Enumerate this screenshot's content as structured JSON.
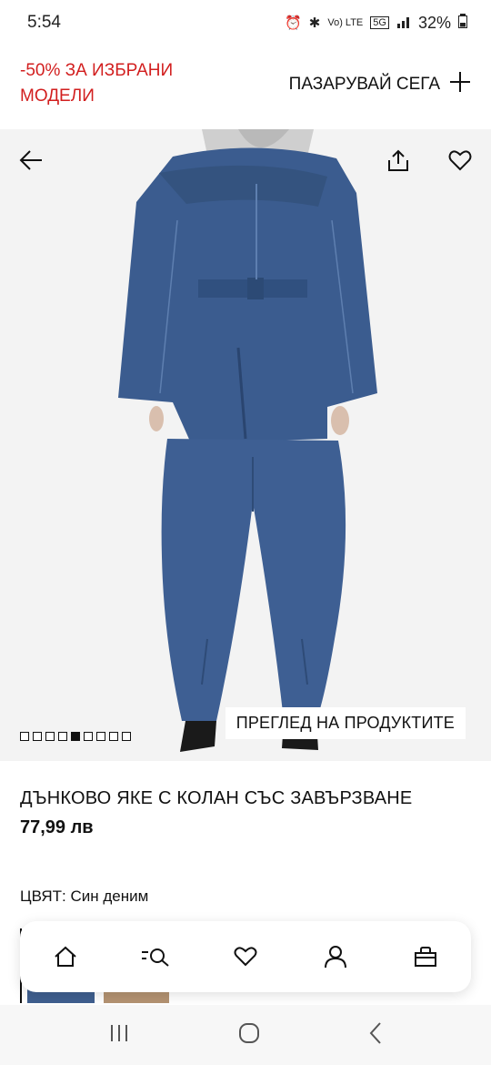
{
  "status_bar": {
    "time": "5:54",
    "network_label": "Vo) LTE",
    "signal_label": "5G",
    "battery": "32%"
  },
  "promo": {
    "text": "-50% ЗА ИЗБРАНИ МОДЕЛИ",
    "cta": "ПАЗАРУВАЙ СЕГА"
  },
  "hero": {
    "image_index": 5,
    "image_count": 9,
    "preview_button": "ПРЕГЛЕД НА ПРОДУКТИТЕ"
  },
  "product": {
    "name": "ДЪНКОВО ЯКЕ С КОЛАН СЪС ЗАВЪРЗВАНЕ",
    "price": "77,99 лв",
    "color_label": "ЦВЯТ:",
    "color_value": "Син деним",
    "swatch_colors": [
      "#3f5f8f",
      "#b49372"
    ]
  },
  "bottom_nav": {
    "items": [
      "home-icon",
      "search-icon",
      "heart-icon",
      "user-icon",
      "bag-icon"
    ]
  },
  "colors": {
    "promo_red": "#d21f1f",
    "denim": "#3b5c8f",
    "background": "#f3f3f3"
  }
}
